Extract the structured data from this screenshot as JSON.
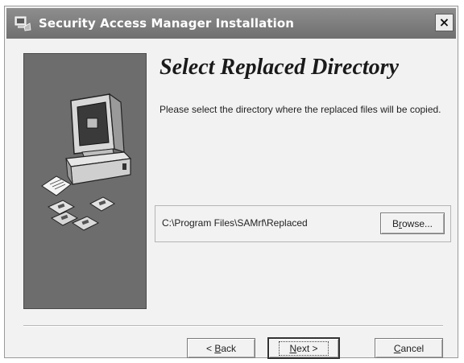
{
  "window": {
    "title": "Security Access Manager Installation",
    "close_label": "×"
  },
  "page": {
    "heading": "Select Replaced Directory",
    "instructions": "Please select the directory where the replaced  files will be copied."
  },
  "directory": {
    "path": "C:\\Program Files\\SAMrf\\Replaced",
    "browse": {
      "pre": "B",
      "key": "r",
      "post": "owse..."
    }
  },
  "buttons": {
    "back": {
      "pre": "< ",
      "key": "B",
      "post": "ack"
    },
    "next": {
      "pre": "",
      "key": "N",
      "post": "ext >"
    },
    "cancel": {
      "pre": "",
      "key": "C",
      "post": "ancel"
    }
  },
  "icons": {
    "title": "installer-icon",
    "side": "computer-with-disks-illustration"
  },
  "colors": {
    "titlebar": "#7f7f7f",
    "side_panel": "#6d6d6d",
    "dialog_bg": "#f2f2f2"
  }
}
